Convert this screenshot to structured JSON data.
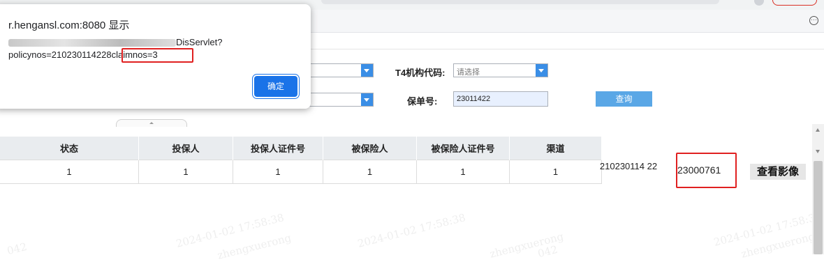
{
  "dialog": {
    "title": "r.hengansl.com:8080 显示",
    "message_line1_suffix": "DisServlet?",
    "message_line2_prefix": "policynos=210230114228",
    "message_highlight": "claimnos=3",
    "ok_label": "确定"
  },
  "form": {
    "org_label": "T4机构代码:",
    "org_placeholder": "请选择",
    "policy_label": "保单号:",
    "policy_value": "23011422",
    "query_label": "查询"
  },
  "table": {
    "headers": [
      "状态",
      "投保人",
      "投保人证件号",
      "被保险人",
      "被保险人证件号",
      "渠道"
    ],
    "row": [
      "1",
      "1",
      "1",
      "1",
      "1",
      "1"
    ],
    "policy_no": "210230114 22",
    "claim_no": "23000761",
    "view_label": "查看影像"
  },
  "watermarks": {
    "timestamp": "2024-01-02 17:58:38",
    "user": "zhengxuerong",
    "code": "042"
  },
  "colors": {
    "accent": "#1a73e8",
    "highlight_box": "#e02020",
    "query_button": "#5aa7e6"
  }
}
